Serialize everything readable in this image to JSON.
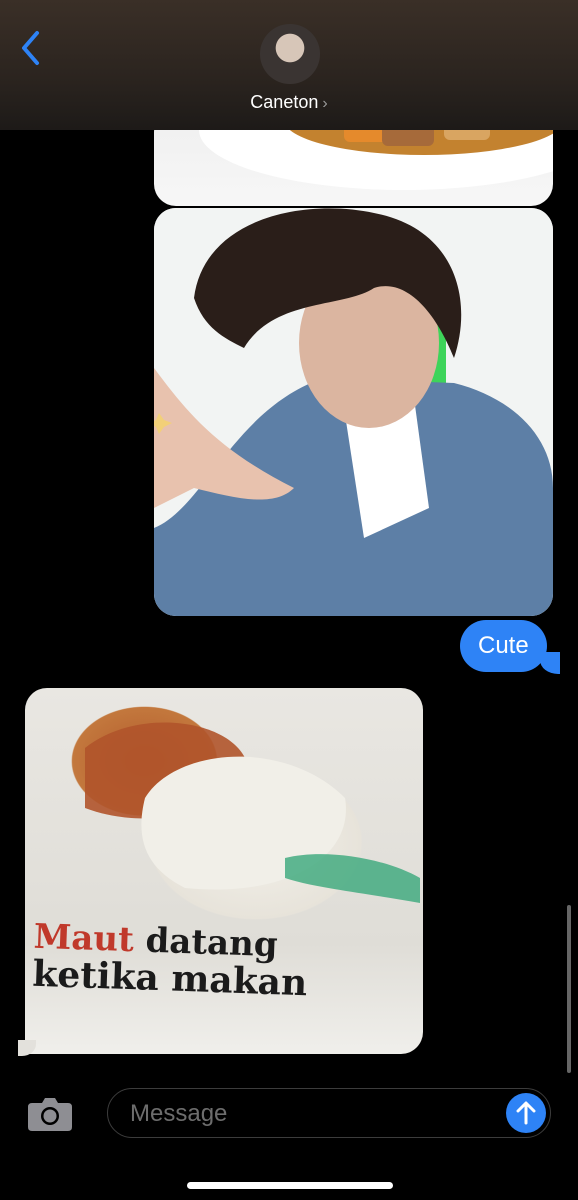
{
  "header": {
    "contact_name": "Caneton",
    "chevron": "›"
  },
  "messages": {
    "sent_text": "Cute"
  },
  "newspaper": {
    "headline_red": "Maut",
    "headline_1_rest": " datang",
    "headline_2": "ketika makan"
  },
  "input": {
    "placeholder": "Message"
  },
  "icons": {
    "back": "chevron-left-icon",
    "camera": "camera-icon",
    "send": "arrow-up-icon"
  },
  "colors": {
    "accent": "#2e83f6",
    "background": "#000000"
  }
}
